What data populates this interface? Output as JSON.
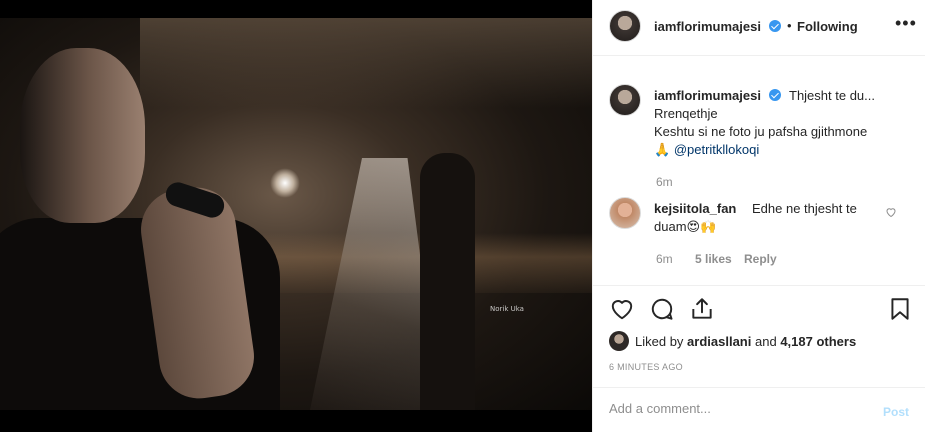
{
  "post": {
    "watermark": "Norik Uka"
  },
  "header": {
    "username": "iamflorimumajesi",
    "dot": "•",
    "following_label": "Following",
    "more_label": "•••"
  },
  "caption": {
    "username": "iamflorimumajesi",
    "first_line": "Thjesht te du...",
    "line2": "Rrenqethje",
    "line3": "Keshtu si ne foto ju pafsha gjithmone",
    "emoji": "🙏",
    "mention": "@petritkllokoqi",
    "time": "6m"
  },
  "comment": {
    "username": "kejsiitola_fan",
    "text_part1": "Edhe ne thjesht te",
    "text_part2": "duam😍🙌",
    "time": "6m",
    "likes": "5 likes",
    "reply_label": "Reply"
  },
  "likes": {
    "prefix": "Liked by",
    "user": "ardiasllani",
    "and": "and",
    "others": "4,187 others"
  },
  "timestamp": "6 MINUTES AGO",
  "add_comment": {
    "placeholder": "Add a comment...",
    "post_label": "Post"
  },
  "colors": {
    "verified_blue": "#3897f0",
    "post_disabled": "#b2dffc",
    "secondary_text": "#8e8e8e",
    "mention": "#003569"
  }
}
